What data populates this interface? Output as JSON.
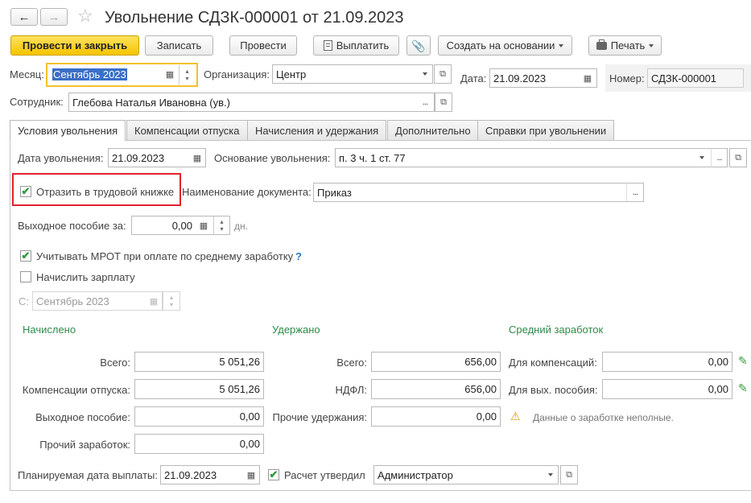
{
  "header": {
    "title": "Увольнение СДЗК-000001 от 21.09.2023"
  },
  "toolbar": {
    "post_close": "Провести и закрыть",
    "save": "Записать",
    "post": "Провести",
    "pay": "Выплатить",
    "create_based": "Создать на основании",
    "print": "Печать"
  },
  "form": {
    "month_label": "Месяц:",
    "month_value": "Сентябрь 2023",
    "org_label": "Организация:",
    "org_value": "Центр",
    "date_label": "Дата:",
    "date_value": "21.09.2023",
    "number_label": "Номер:",
    "number_value": "СДЗК-000001",
    "employee_label": "Сотрудник:",
    "employee_value": "Глебова Наталья Ивановна (ув.)"
  },
  "tabs": [
    {
      "label": "Условия увольнения"
    },
    {
      "label": "Компенсации отпуска"
    },
    {
      "label": "Начисления и удержания"
    },
    {
      "label": "Дополнительно"
    },
    {
      "label": "Справки при увольнении"
    }
  ],
  "conditions": {
    "dismissal_date_label": "Дата увольнения:",
    "dismissal_date": "21.09.2023",
    "basis_label": "Основание увольнения:",
    "basis_value": "п. 3 ч. 1 ст. 77",
    "reflect_label": "Отразить в трудовой книжке",
    "reflect_checked": true,
    "doc_name_label": "Наименование документа:",
    "doc_name_value": "Приказ",
    "severance_label": "Выходное пособие за:",
    "severance_value": "0,00",
    "severance_unit": "дн.",
    "mrot_label": "Учитывать МРОТ при оплате по среднему заработку",
    "mrot_checked": true,
    "help": "?",
    "salary_label": "Начислить зарплату",
    "salary_checked": false,
    "from_label": "С:",
    "from_value": "Сентябрь 2023"
  },
  "accrued": {
    "title": "Начислено",
    "total_label": "Всего:",
    "total": "5 051,26",
    "vacation_label": "Компенсации отпуска:",
    "vacation": "5 051,26",
    "severance_label": "Выходное пособие:",
    "severance": "0,00",
    "other_label": "Прочий заработок:",
    "other": "0,00"
  },
  "withheld": {
    "title": "Удержано",
    "total_label": "Всего:",
    "total": "656,00",
    "ndfl_label": "НДФЛ:",
    "ndfl": "656,00",
    "other_label": "Прочие удержания:",
    "other": "0,00"
  },
  "average": {
    "title": "Средний заработок",
    "comp_label": "Для компенсаций:",
    "comp": "0,00",
    "sev_label": "Для вых. пособия:",
    "sev": "0,00",
    "warning": "Данные о заработке неполные."
  },
  "footer": {
    "pay_date_label": "Планируемая дата выплаты:",
    "pay_date": "21.09.2023",
    "approved_label": "Расчет утвердил",
    "approved_checked": true,
    "approver": "Администратор"
  },
  "colors": {
    "accent_yellow": "#f5c400",
    "section_green": "#2e8b4a",
    "highlight_red": "#e0232b",
    "check_green": "#2e9a3e"
  }
}
